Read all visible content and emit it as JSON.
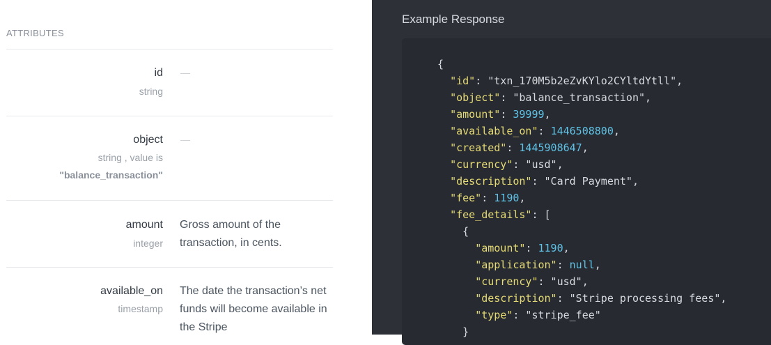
{
  "attributes": {
    "section_title": "ATTRIBUTES",
    "dash": "—",
    "items": [
      {
        "name": "id",
        "type": "string",
        "description": ""
      },
      {
        "name": "object",
        "type": "string , value is",
        "type_value": "\"balance_transaction\"",
        "description": ""
      },
      {
        "name": "amount",
        "type": "integer",
        "description": "Gross amount of the transaction, in cents."
      },
      {
        "name": "available_on",
        "type": "timestamp",
        "description": "The date the transaction’s net funds will become available in the Stripe"
      }
    ]
  },
  "response": {
    "title": "Example Response",
    "lines": [
      {
        "indent": 0,
        "parts": [
          {
            "c": "p",
            "t": "{"
          }
        ]
      },
      {
        "indent": 1,
        "parts": [
          {
            "c": "k",
            "t": "\"id\""
          },
          {
            "c": "p",
            "t": ": \"txn_170M5b2eZvKYlo2CYltdYtll\","
          }
        ]
      },
      {
        "indent": 1,
        "parts": [
          {
            "c": "k",
            "t": "\"object\""
          },
          {
            "c": "p",
            "t": ": \"balance_transaction\","
          }
        ]
      },
      {
        "indent": 1,
        "parts": [
          {
            "c": "k",
            "t": "\"amount\""
          },
          {
            "c": "p",
            "t": ": "
          },
          {
            "c": "n",
            "t": "39999"
          },
          {
            "c": "p",
            "t": ","
          }
        ]
      },
      {
        "indent": 1,
        "parts": [
          {
            "c": "k",
            "t": "\"available_on\""
          },
          {
            "c": "p",
            "t": ": "
          },
          {
            "c": "n",
            "t": "1446508800"
          },
          {
            "c": "p",
            "t": ","
          }
        ]
      },
      {
        "indent": 1,
        "parts": [
          {
            "c": "k",
            "t": "\"created\""
          },
          {
            "c": "p",
            "t": ": "
          },
          {
            "c": "n",
            "t": "1445908647"
          },
          {
            "c": "p",
            "t": ","
          }
        ]
      },
      {
        "indent": 1,
        "parts": [
          {
            "c": "k",
            "t": "\"currency\""
          },
          {
            "c": "p",
            "t": ": \"usd\","
          }
        ]
      },
      {
        "indent": 1,
        "parts": [
          {
            "c": "k",
            "t": "\"description\""
          },
          {
            "c": "p",
            "t": ": \"Card Payment\","
          }
        ]
      },
      {
        "indent": 1,
        "parts": [
          {
            "c": "k",
            "t": "\"fee\""
          },
          {
            "c": "p",
            "t": ": "
          },
          {
            "c": "n",
            "t": "1190"
          },
          {
            "c": "p",
            "t": ","
          }
        ]
      },
      {
        "indent": 1,
        "parts": [
          {
            "c": "k",
            "t": "\"fee_details\""
          },
          {
            "c": "p",
            "t": ": ["
          }
        ]
      },
      {
        "indent": 2,
        "parts": [
          {
            "c": "p",
            "t": "{"
          }
        ]
      },
      {
        "indent": 3,
        "parts": [
          {
            "c": "k",
            "t": "\"amount\""
          },
          {
            "c": "p",
            "t": ": "
          },
          {
            "c": "n",
            "t": "1190"
          },
          {
            "c": "p",
            "t": ","
          }
        ]
      },
      {
        "indent": 3,
        "parts": [
          {
            "c": "k",
            "t": "\"application\""
          },
          {
            "c": "p",
            "t": ": "
          },
          {
            "c": "n",
            "t": "null"
          },
          {
            "c": "p",
            "t": ","
          }
        ]
      },
      {
        "indent": 3,
        "parts": [
          {
            "c": "k",
            "t": "\"currency\""
          },
          {
            "c": "p",
            "t": ": \"usd\","
          }
        ]
      },
      {
        "indent": 3,
        "parts": [
          {
            "c": "k",
            "t": "\"description\""
          },
          {
            "c": "p",
            "t": ": \"Stripe processing fees\","
          }
        ]
      },
      {
        "indent": 3,
        "parts": [
          {
            "c": "k",
            "t": "\"type\""
          },
          {
            "c": "p",
            "t": ": \"stripe_fee\""
          }
        ]
      },
      {
        "indent": 2,
        "parts": [
          {
            "c": "p",
            "t": "}"
          }
        ]
      }
    ]
  },
  "colors": {
    "left_bg": "#ffffff",
    "right_bg": "#2d3137",
    "code_bg": "#272a30",
    "key": "#e6db74",
    "number": "#5fc3e8",
    "text": "#d7dbe0"
  }
}
